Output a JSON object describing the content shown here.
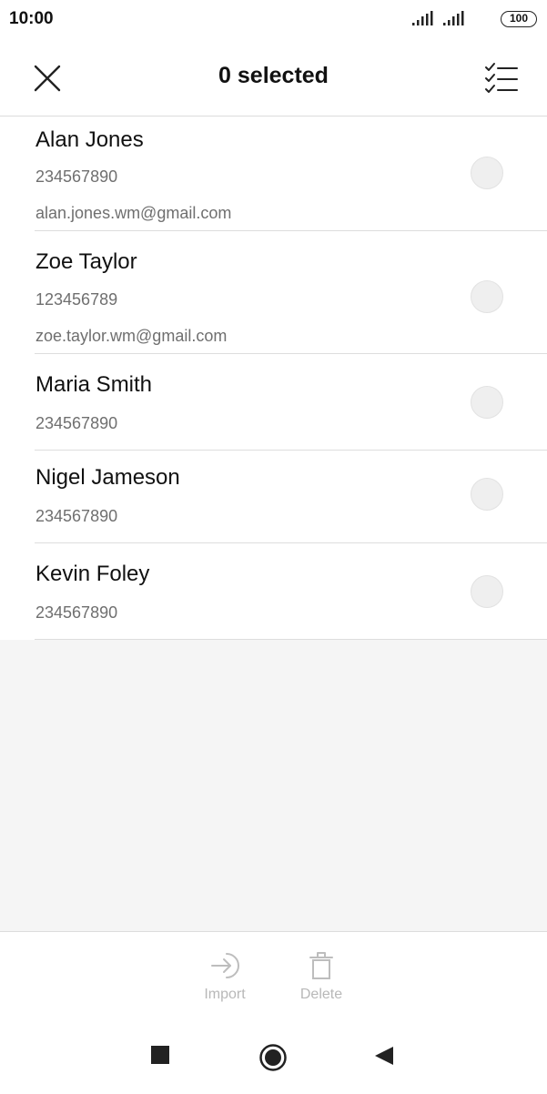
{
  "status_bar": {
    "time": "10:00",
    "battery": "100",
    "icons": [
      "signal-icon",
      "signal-icon",
      "battery-icon"
    ]
  },
  "header": {
    "title": "0 selected",
    "close_icon": "close-icon",
    "select_all_icon": "select-all-checklist-icon"
  },
  "contacts": [
    {
      "name": "Alan Jones",
      "phone": "234567890",
      "email": "alan.jones.wm@gmail.com",
      "selected": false
    },
    {
      "name": "Zoe Taylor",
      "phone": "123456789",
      "email": "zoe.taylor.wm@gmail.com",
      "selected": false
    },
    {
      "name": "Maria Smith",
      "phone": "234567890",
      "email": "",
      "selected": false
    },
    {
      "name": "Nigel Jameson",
      "phone": "234567890",
      "email": "",
      "selected": false
    },
    {
      "name": "Kevin Foley",
      "phone": "234567890",
      "email": "",
      "selected": false
    }
  ],
  "actions": {
    "import": {
      "label": "Import",
      "icon": "import-icon",
      "enabled": false
    },
    "delete": {
      "label": "Delete",
      "icon": "trash-icon",
      "enabled": false
    }
  },
  "navbar": {
    "icons": [
      "recents-square-icon",
      "home-circle-icon",
      "back-triangle-icon"
    ]
  }
}
